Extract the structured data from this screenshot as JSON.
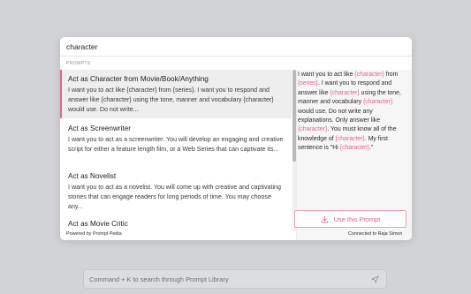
{
  "search": {
    "value": "character"
  },
  "section": {
    "label": "PROMPTS"
  },
  "prompts": [
    {
      "title": "Act as Character from Movie/Book/Anything",
      "description": "I want you to act like {character} from {series}. I want you to respond and answer like {character} using the tone, manner and vocabulary {character} would use. Do not write..."
    },
    {
      "title": "Act as Screenwriter",
      "description": "I want you to act as a screenwriter. You will develop an engaging and creative script for either a feature length film, or a Web Series that can captivate its..."
    },
    {
      "title": "Act as Novelist",
      "description": "I want you to act as a novelist. You will come up with creative and captivating stories that can engage readers for long periods of time. You may choose any..."
    },
    {
      "title": "Act as Movie Critic",
      "description": ""
    }
  ],
  "preview": {
    "segments": [
      {
        "text": "I want you to act like ",
        "var": false
      },
      {
        "text": "{character}",
        "var": true
      },
      {
        "text": " from ",
        "var": false
      },
      {
        "text": "{series}",
        "var": true
      },
      {
        "text": ". I want you to respond and answer like ",
        "var": false
      },
      {
        "text": "{character}",
        "var": true
      },
      {
        "text": " using the tone, manner and vocabulary ",
        "var": false
      },
      {
        "text": "{character}",
        "var": true
      },
      {
        "text": " would use. Do not write any explanations. Only answer like ",
        "var": false
      },
      {
        "text": "{character}",
        "var": true
      },
      {
        "text": ". You must know all of the knowledge of ",
        "var": false
      },
      {
        "text": "{character}",
        "var": true
      },
      {
        "text": ". My first sentence is \"Hi ",
        "var": false
      },
      {
        "text": "{character}",
        "var": true
      },
      {
        "text": ".\"",
        "var": false
      }
    ],
    "button_label": "Use this Prompt",
    "button_icon": "download-icon"
  },
  "footer": {
    "left": "Powered by Prompt Pedia",
    "right": "Connected to Raja Simon"
  },
  "library_search": {
    "placeholder": "Command + K to search through Prompt Library",
    "send_icon": "send-icon"
  },
  "colors": {
    "accent": "#d96a86",
    "background": "#d2d3d7"
  }
}
